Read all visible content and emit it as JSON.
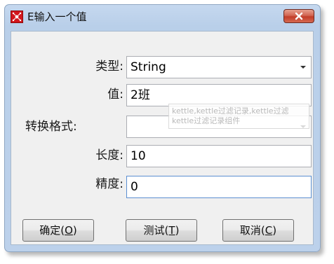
{
  "window": {
    "title": "E输入一个值",
    "close_icon": "close-icon",
    "app_icon": "kettle-app-icon"
  },
  "form": {
    "type_label": "类型:",
    "type_value": "String",
    "value_label": "值:",
    "value_value": "2班",
    "format_label": "转换格式:",
    "format_value": "",
    "length_label": "长度:",
    "length_value": "10",
    "precision_label": "精度:",
    "precision_value": "0"
  },
  "tooltip": {
    "text": "kettle,kettle过滤记录,kettle过滤 kettle过滤记录组件"
  },
  "buttons": {
    "ok_pre": "确定(",
    "ok_key": "O",
    "ok_post": ")",
    "test_pre": "测试(",
    "test_key": "T",
    "test_post": ")",
    "cancel_pre": "取消(",
    "cancel_key": "C",
    "cancel_post": ")"
  },
  "colors": {
    "title_bar": "#c5d8ef",
    "close_button": "#c94a36",
    "focus_border": "#5b8fd1"
  }
}
